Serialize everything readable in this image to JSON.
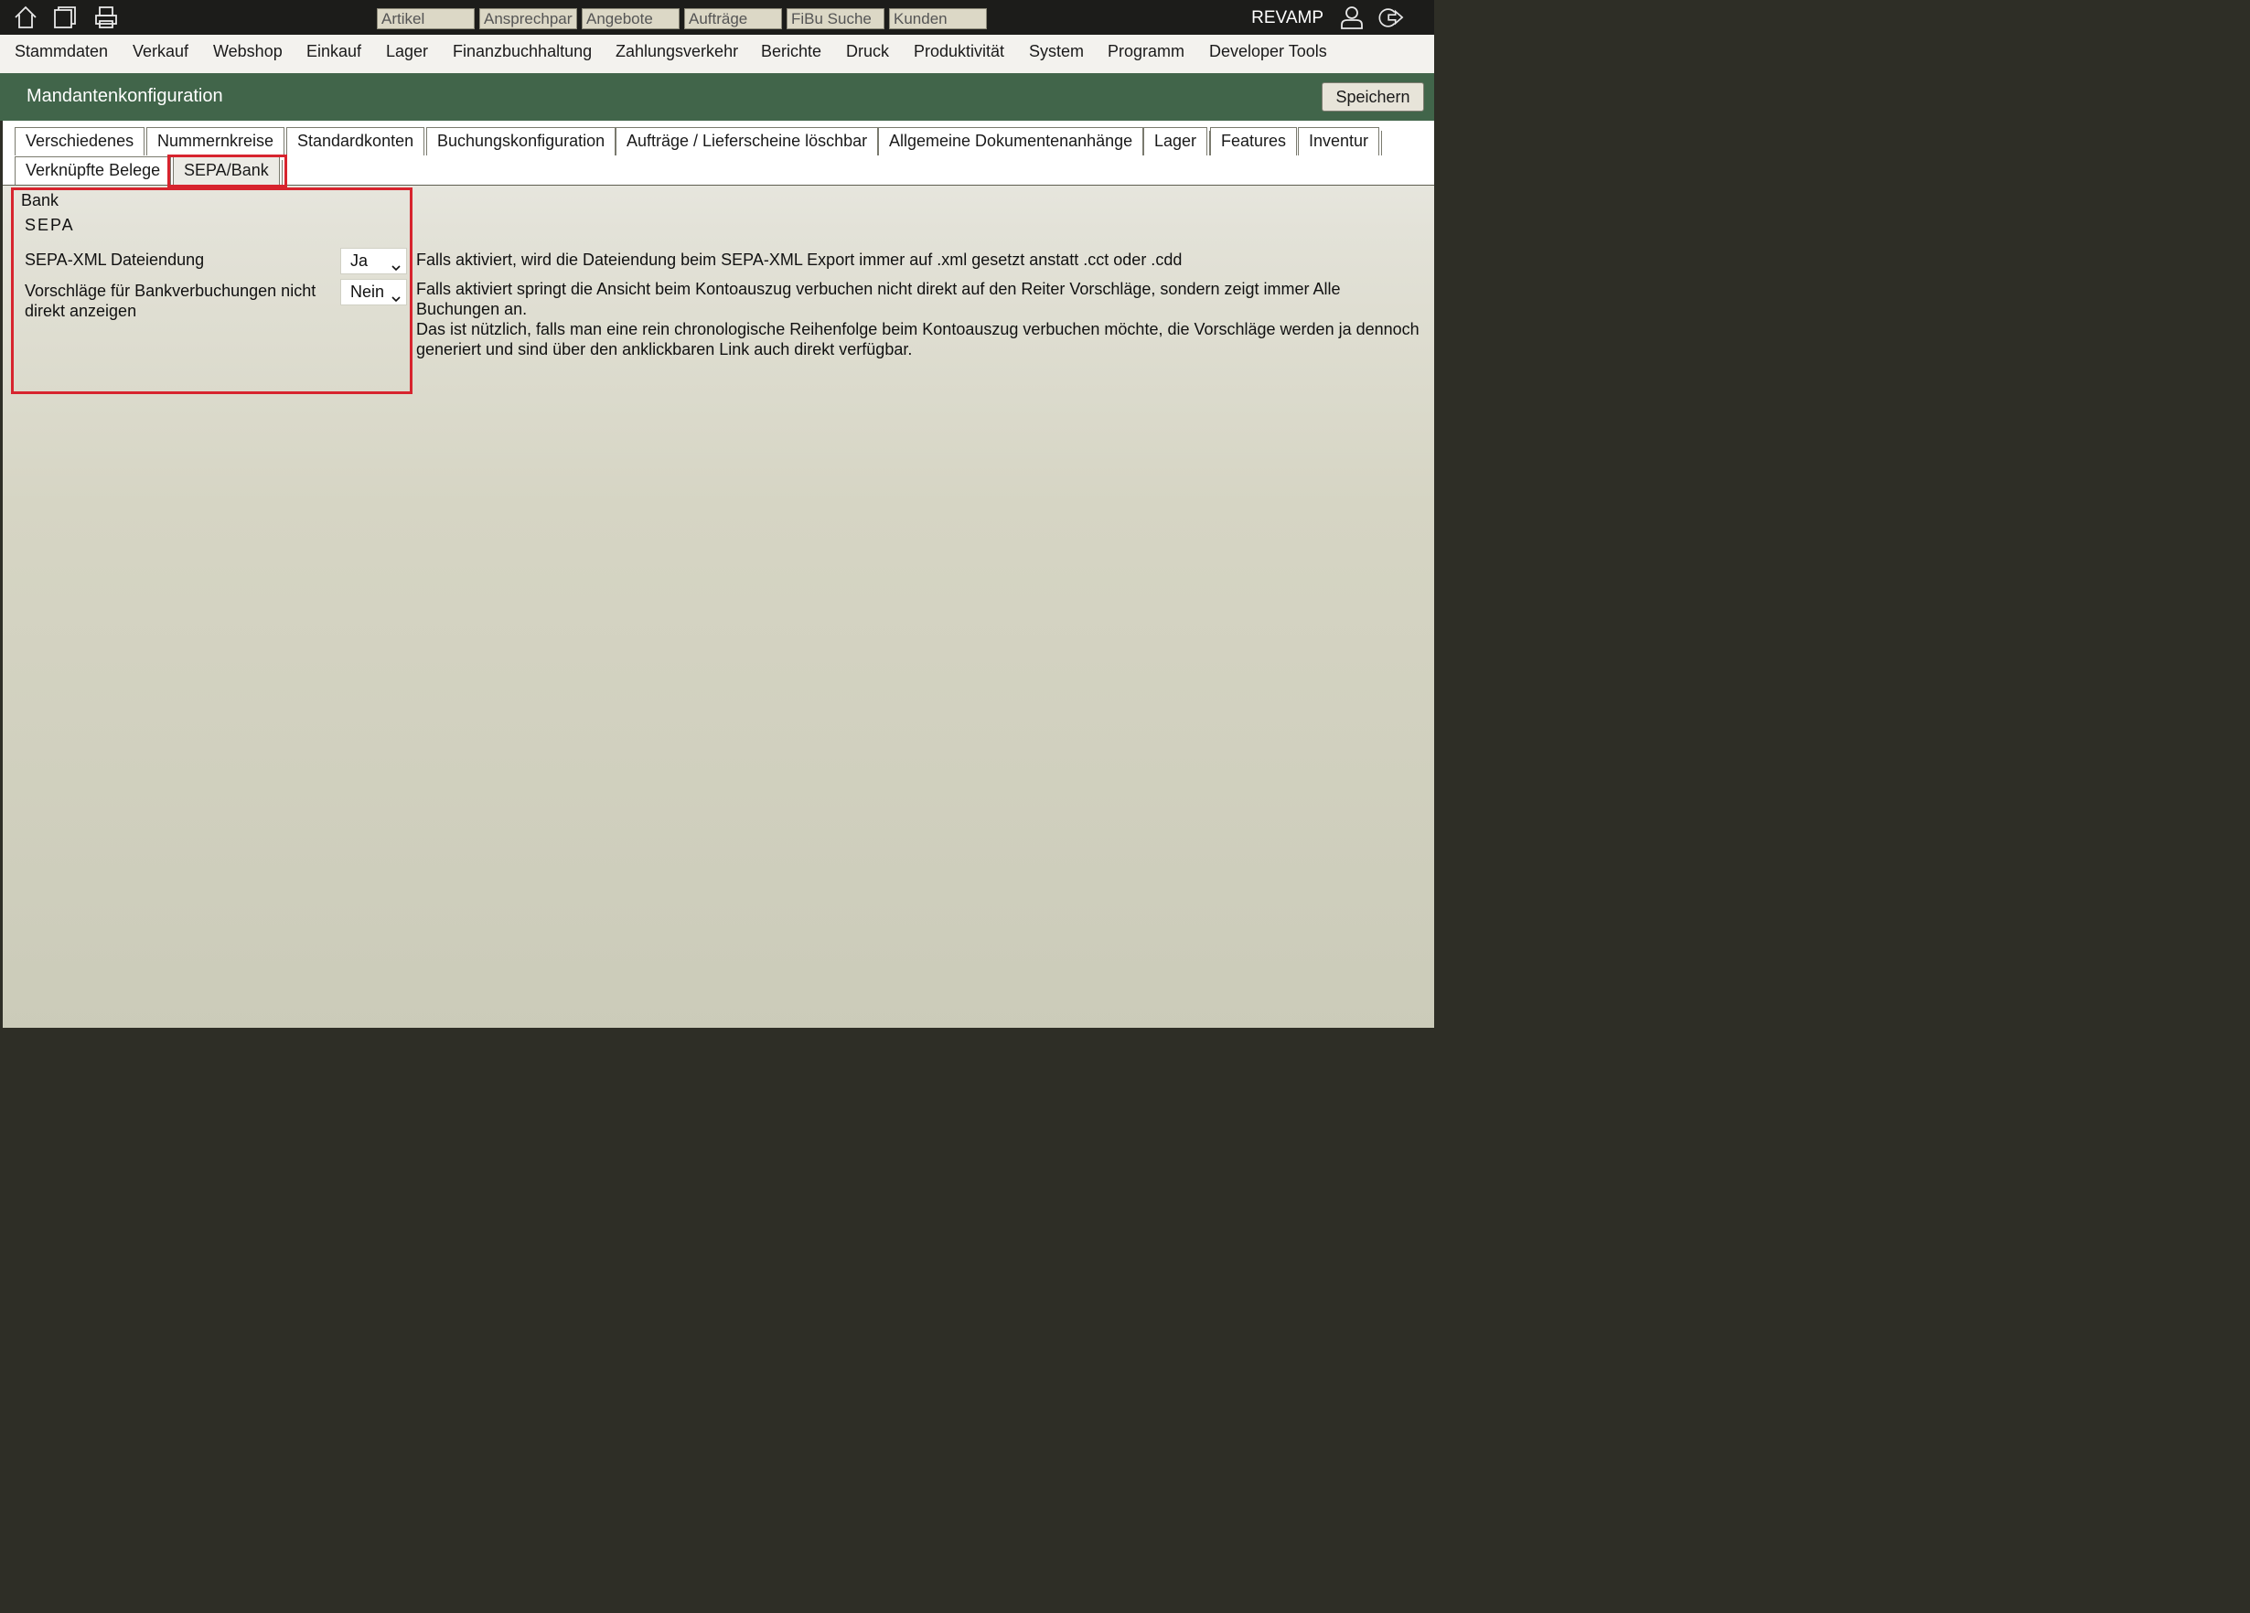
{
  "topbar": {
    "icons": [
      "home-icon",
      "window-icon",
      "printer-icon",
      "user-icon",
      "logout-icon"
    ],
    "quicksearch": [
      {
        "placeholder": "Artikel"
      },
      {
        "placeholder": "Ansprechpartner"
      },
      {
        "placeholder": "Angebote"
      },
      {
        "placeholder": "Aufträge"
      },
      {
        "placeholder": "FiBu Suche"
      },
      {
        "placeholder": "Kunden"
      }
    ],
    "company": "REVAMP"
  },
  "menu": {
    "items": [
      "Stammdaten",
      "Verkauf",
      "Webshop",
      "Einkauf",
      "Lager",
      "Finanzbuchhaltung",
      "Zahlungsverkehr",
      "Berichte",
      "Druck",
      "Produktivität",
      "System",
      "Programm",
      "Developer Tools"
    ]
  },
  "header": {
    "title": "Mandantenkonfiguration",
    "save_label": "Speichern",
    "color": "#41654a"
  },
  "tabs": {
    "row1": [
      "Verschiedenes",
      "Nummernkreise",
      "Standardkonten",
      "Buchungskonfiguration",
      "Aufträge / Lieferscheine löschbar",
      "Allgemeine Dokumentenanhänge",
      "Lager",
      "Features",
      "Inventur"
    ],
    "row2": [
      "Verknüpfte Belege",
      "SEPA/Bank"
    ],
    "active": "SEPA/Bank"
  },
  "section": {
    "label": "Bank",
    "heading": "SEPA",
    "fields": [
      {
        "label": "SEPA-XML Dateiendung",
        "value": "Ja",
        "description": "Falls aktiviert, wird die Dateiendung beim SEPA-XML Export immer auf .xml gesetzt anstatt .cct oder .cdd"
      },
      {
        "label": "Vorschläge für Bankverbuchungen nicht direkt anzeigen",
        "value": "Nein",
        "description": "Falls aktiviert springt die Ansicht beim Kontoauszug verbuchen nicht direkt auf den Reiter Vorschläge, sondern zeigt immer Alle Buchungen an.",
        "description2": "Das ist nützlich, falls man eine rein chronologische Reihenfolge beim Kontoauszug verbuchen möchte, die Vorschläge werden ja dennoch generiert und sind über den anklickbaren Link auch direkt verfügbar."
      }
    ]
  },
  "highlight_color": "#d7242e"
}
